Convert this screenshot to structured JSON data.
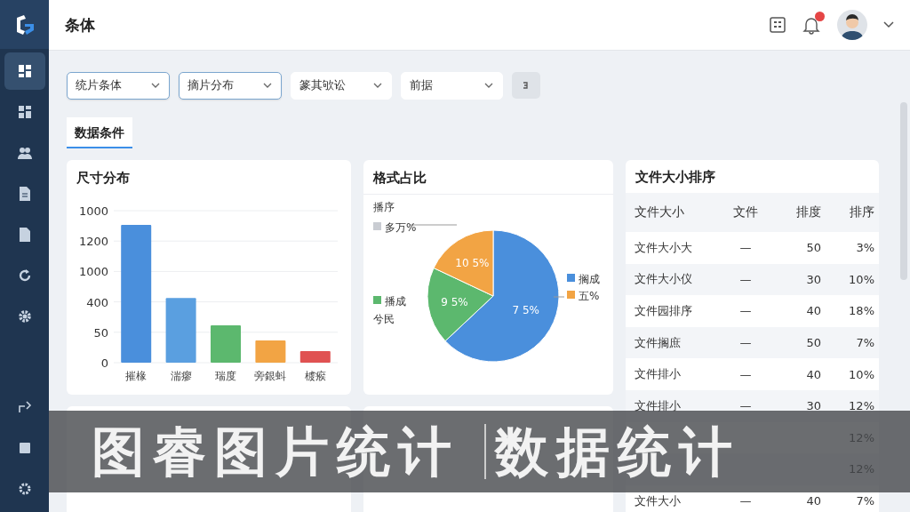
{
  "sidebar": {
    "items": [
      {
        "selected": true
      },
      {
        "selected": false
      },
      {
        "selected": false
      },
      {
        "selected": false
      },
      {
        "selected": false
      },
      {
        "selected": false
      },
      {
        "selected": false
      },
      {
        "selected": false
      },
      {
        "selected": false
      },
      {
        "selected": false
      }
    ]
  },
  "header": {
    "title": "条体"
  },
  "filters": [
    {
      "label": "统片条体",
      "focused": true
    },
    {
      "label": "摘片分布",
      "focused": true
    },
    {
      "label": "篆其欨讼",
      "focused": false
    },
    {
      "label": "前据",
      "focused": false
    }
  ],
  "tabs": [
    {
      "label": "数据条件",
      "selected": true
    }
  ],
  "size_card": {
    "title": "尺寸分布",
    "axis_labels": [
      "1000",
      "1200",
      "1000",
      "400",
      "50",
      "0"
    ],
    "bars": [
      {
        "label": "摧椽",
        "color": "#4a8fdc"
      },
      {
        "label": "湍瘳",
        "color": "#5a9fe0"
      },
      {
        "label": "瑞度",
        "color": "#5cb86e"
      },
      {
        "label": "旁銀蚪",
        "color": "#f2a444"
      },
      {
        "label": "榩瘊",
        "color": "#e05252"
      }
    ]
  },
  "format_card": {
    "title": "格式占比",
    "slices": [
      {
        "label": "7 5%",
        "color": "#4a8fdc"
      },
      {
        "label": "9 5%",
        "color": "#5cb86e"
      },
      {
        "label": "10 5%",
        "color": "#f2a444"
      }
    ],
    "legend_top": {
      "title": "播序",
      "label": "多万%",
      "color": "#c9ccd2"
    },
    "legend_left": {
      "label": "播成",
      "note": "兮民",
      "color": "#5cb86e"
    },
    "legend_right": [
      {
        "label": "搁成",
        "color": "#4a8fdc"
      },
      {
        "label": "五%",
        "color": "#f2a444"
      }
    ]
  },
  "table_card": {
    "title": "文件大小排序",
    "columns": [
      "文件大小",
      "文件",
      "排度",
      "排序"
    ],
    "rows": [
      {
        "name": "文件大小大",
        "file": "—",
        "rank": "50",
        "share": "3%"
      },
      {
        "name": "文件大小仪",
        "file": "—",
        "rank": "30",
        "share": "10%"
      },
      {
        "name": "文件园排序",
        "file": "—",
        "rank": "40",
        "share": "18%"
      },
      {
        "name": "文件搁庶",
        "file": "—",
        "rank": "50",
        "share": "7%"
      },
      {
        "name": "文件排小",
        "file": "—",
        "rank": "40",
        "share": "10%"
      },
      {
        "name": "文件排小",
        "file": "—",
        "rank": "30",
        "share": "12%"
      },
      {
        "share": "12%"
      },
      {
        "share": "12%"
      },
      {
        "name": "文件大小",
        "file": "—",
        "rank": "40",
        "share": "7%"
      }
    ]
  },
  "banner": {
    "title": "图睿图片统计",
    "subtitle": "数据统计"
  }
}
